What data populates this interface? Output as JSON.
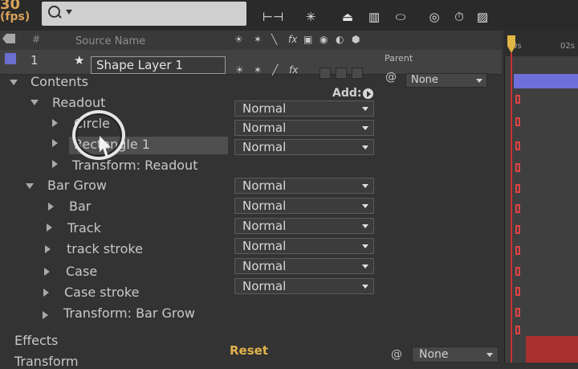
{
  "header": {
    "fps": "(fps)",
    "fps_value": "30",
    "search_placeholder": ""
  },
  "columns": {
    "source_name": "Source Name",
    "parent": "Parent",
    "index_glyph": "#"
  },
  "layer": {
    "index": "1",
    "name": "Shape Layer 1",
    "parent_value": "None"
  },
  "switch_icons": {
    "row_header": [
      "☀",
      "✶",
      "╲",
      "fx",
      "▣",
      "◉",
      "◐",
      "⬢"
    ],
    "row_layer": [
      "☀",
      "✶",
      "╱",
      "fx"
    ]
  },
  "tree": {
    "contents": "Contents",
    "add_label": "Add:",
    "readout": "Readout",
    "circle": "Circle",
    "rectangle": "Rectangle 1",
    "transform_readout": "Transform: Readout",
    "bar_grow": "Bar Grow",
    "bar": "Bar",
    "track": "Track",
    "track_stroke": "track stroke",
    "case": "Case",
    "case_stroke": "Case stroke",
    "transform_bar_grow": "Transform: Bar Grow",
    "effects": "Effects",
    "transform": "Transform",
    "reset": "Reset",
    "transform_parent": "None"
  },
  "blend_mode": "Normal",
  "timeline": {
    "tick_start": "0s",
    "tick_next": "02s"
  },
  "colors": {
    "layer_label": "#6a6fd0",
    "reset": "#e0b24a",
    "playhead": "#e1b546",
    "keyframe": "#d44444"
  }
}
